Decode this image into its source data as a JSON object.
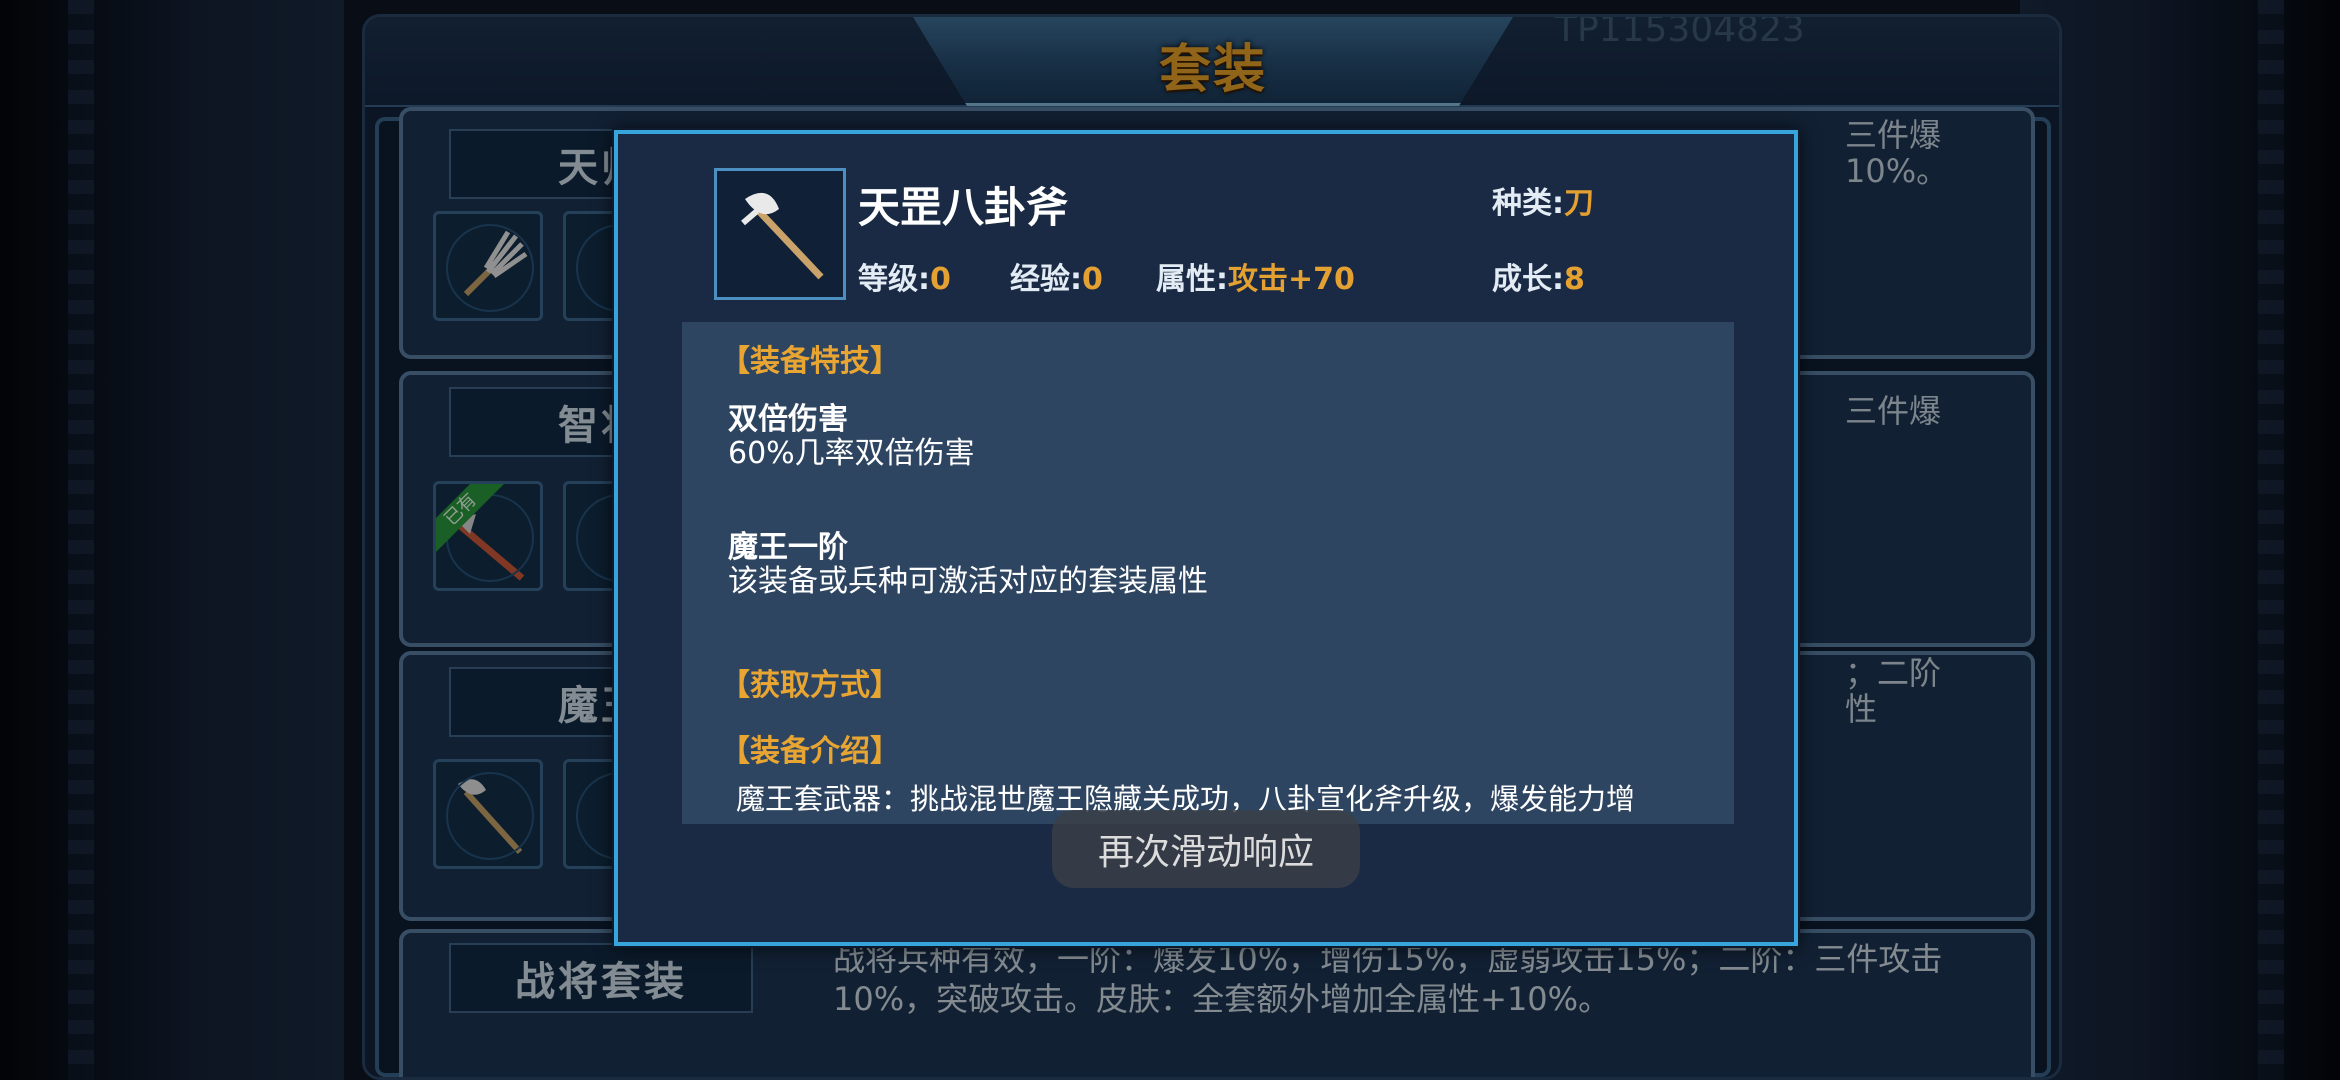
{
  "window": {
    "title": "套装",
    "faded_id": "TP115304823"
  },
  "suits": [
    {
      "name": "天师",
      "desc_fragment": "三件爆\n10%。"
    },
    {
      "name": "智将",
      "desc_fragment": "三件爆",
      "owned_label": "已有"
    },
    {
      "name": "魔王",
      "desc_fragment": "；二阶\n性"
    },
    {
      "name": "战将套装",
      "desc": "战将兵种有效，一阶：爆发10%，增伤15%，虚弱攻击15%；二阶：三件攻击10%，突破攻击。皮肤：全套额外增加全属性+10%。"
    }
  ],
  "item": {
    "name": "天罡八卦斧",
    "icon": "axe-icon",
    "stats": {
      "type_label": "种类:",
      "type_value": "刀",
      "level_label": "等级:",
      "level_value": "0",
      "exp_label": "经验:",
      "exp_value": "0",
      "attr_label": "属性:",
      "attr_value": "攻击+70",
      "growth_label": "成长:",
      "growth_value": "8"
    },
    "skills_title": "【装备特技】",
    "skills": [
      {
        "name": "双倍伤害",
        "desc": "60%几率双倍伤害"
      },
      {
        "name": "魔王一阶",
        "desc": "该装备或兵种可激活对应的套装属性"
      }
    ],
    "acquire_title": "【获取方式】",
    "intro_title": "【装备介绍】",
    "intro_text": "魔王套武器：挑战混世魔王隐藏关成功，八卦宣化斧升级，爆发能力增"
  },
  "toast": "再次滑动响应",
  "colors": {
    "accent": "#e4a131",
    "popup_border": "#37a4dc",
    "panel": "#2e4562"
  }
}
